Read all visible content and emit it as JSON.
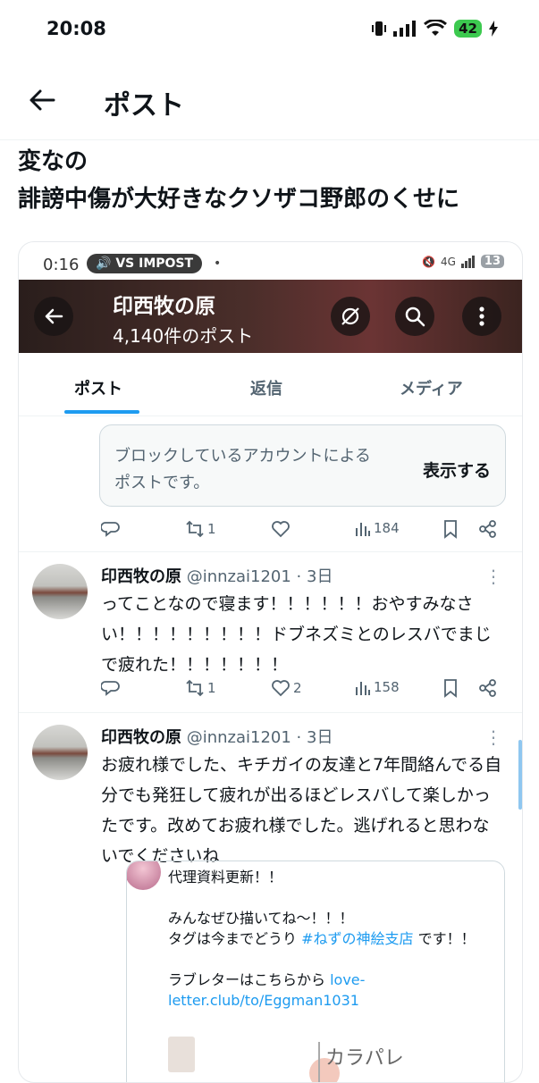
{
  "status_bar": {
    "time": "20:08",
    "battery": "42"
  },
  "header": {
    "title": "ポスト"
  },
  "post": {
    "text": "変なの\n誹謗中傷が大好きなクソザコ野郎のくせに"
  },
  "embedded": {
    "status": {
      "time": "0:16",
      "pill": "VS IMPOST",
      "network": "4G",
      "battery": "13"
    },
    "profile": {
      "name": "印西牧の原",
      "post_count": "4,140件のポスト"
    },
    "tabs": [
      "ポスト",
      "返信",
      "メディア"
    ],
    "blocked": {
      "message": "ブロックしているアカウントによるポストです。",
      "show": "表示する"
    },
    "blocked_actions": {
      "retweets": "1",
      "views": "184"
    },
    "tweets": [
      {
        "name": "印西牧の原",
        "handle": "@innzai1201 · 3日",
        "text": "ってことなので寝ます！！！！！！おやすみなさい！！！！！！！！！ドブネズミとのレスバでまじで疲れた！！！！！！！",
        "retweets": "1",
        "likes": "2",
        "views": "158"
      },
      {
        "name": "印西牧の原",
        "handle": "@innzai1201 · 3日",
        "text": "お疲れ様でした、キチガイの友達と7年間絡んでる自分でも発狂して疲れが出るほどレスバして楽しかったです。改めてお疲れ様でした。逃げれると思わないでくださいね"
      }
    ],
    "quote": {
      "line1": "代理資料更新！！",
      "line2": "みんなぜひ描いてね〜！！！",
      "line3_prefix": "タグは今までどうり ",
      "line3_tag": "#ねずの神絵支店",
      "line3_suffix": " です！！",
      "line4_prefix": "ラブレターはこちらから ",
      "line4_link": "love-letter.club/to/Eggman1031",
      "sketch_text": "カラパレ"
    }
  }
}
